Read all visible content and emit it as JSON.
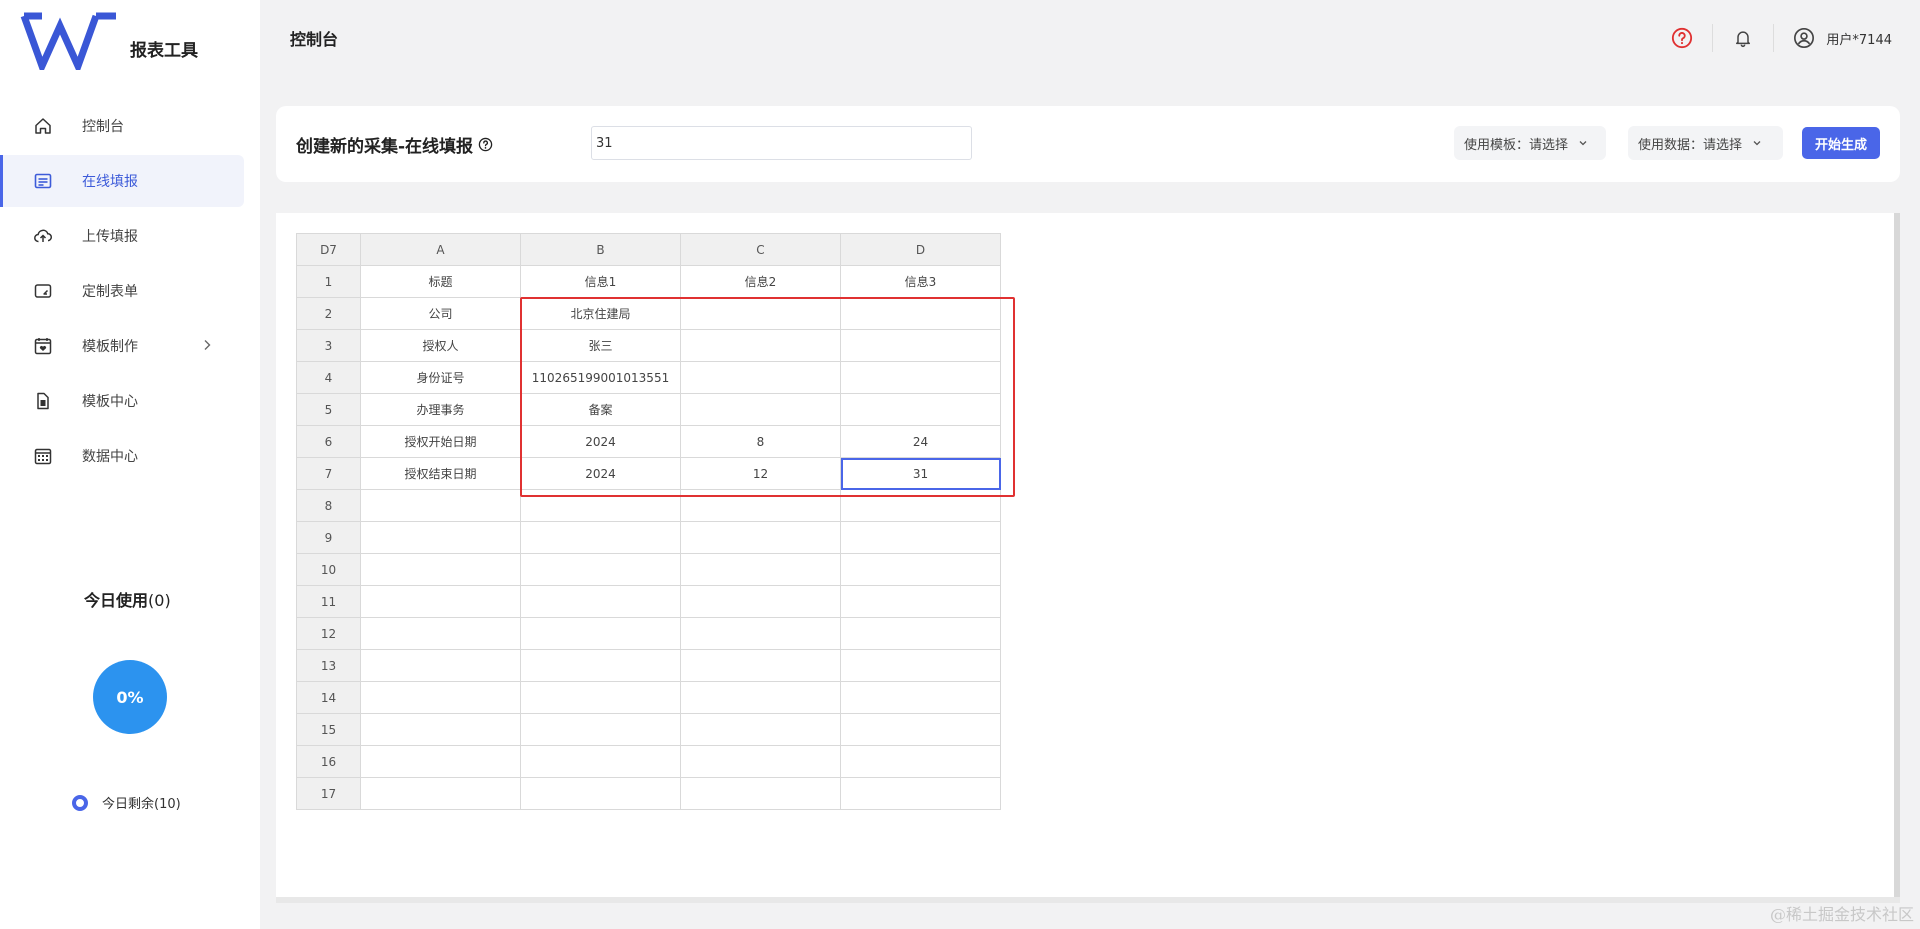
{
  "app": {
    "name": "报表工具"
  },
  "sidebar": {
    "items": [
      {
        "label": "控制台",
        "icon": "home-icon",
        "active": false
      },
      {
        "label": "在线填报",
        "icon": "form-icon",
        "active": true
      },
      {
        "label": "上传填报",
        "icon": "cloud-upload-icon",
        "active": false
      },
      {
        "label": "定制表单",
        "icon": "custom-form-icon",
        "active": false
      },
      {
        "label": "模板制作",
        "icon": "template-icon",
        "active": false,
        "has_submenu": true
      },
      {
        "label": "模板中心",
        "icon": "document-icon",
        "active": false
      },
      {
        "label": "数据中心",
        "icon": "calendar-grid-icon",
        "active": false
      }
    ],
    "usage": {
      "title": "今日使用",
      "count": "(0)",
      "percent": "0%",
      "remaining_label": "今日剩余(10)"
    }
  },
  "header": {
    "title": "控制台",
    "user": "用户*7144"
  },
  "top_card": {
    "title": "创建新的采集-在线填报",
    "name_value": "31",
    "template_select": "使用模板：请选择",
    "data_select": "使用数据：请选择",
    "generate_label": "开始生成"
  },
  "sheet": {
    "corner": "D7",
    "columns": [
      "A",
      "B",
      "C",
      "D"
    ],
    "rows": [
      {
        "n": "1",
        "cells": [
          "标题",
          "信息1",
          "信息2",
          "信息3"
        ]
      },
      {
        "n": "2",
        "cells": [
          "公司",
          "北京住建局",
          "",
          ""
        ]
      },
      {
        "n": "3",
        "cells": [
          "授权人",
          "张三",
          "",
          ""
        ]
      },
      {
        "n": "4",
        "cells": [
          "身份证号",
          "110265199001013551",
          "",
          ""
        ]
      },
      {
        "n": "5",
        "cells": [
          "办理事务",
          "备案",
          "",
          ""
        ]
      },
      {
        "n": "6",
        "cells": [
          "授权开始日期",
          "2024",
          "8",
          "24"
        ]
      },
      {
        "n": "7",
        "cells": [
          "授权结束日期",
          "2024",
          "12",
          "31"
        ]
      },
      {
        "n": "8",
        "cells": [
          "",
          "",
          "",
          ""
        ]
      },
      {
        "n": "9",
        "cells": [
          "",
          "",
          "",
          ""
        ]
      },
      {
        "n": "10",
        "cells": [
          "",
          "",
          "",
          ""
        ]
      },
      {
        "n": "11",
        "cells": [
          "",
          "",
          "",
          ""
        ]
      },
      {
        "n": "12",
        "cells": [
          "",
          "",
          "",
          ""
        ]
      },
      {
        "n": "13",
        "cells": [
          "",
          "",
          "",
          ""
        ]
      },
      {
        "n": "14",
        "cells": [
          "",
          "",
          "",
          ""
        ]
      },
      {
        "n": "15",
        "cells": [
          "",
          "",
          "",
          ""
        ]
      },
      {
        "n": "16",
        "cells": [
          "",
          "",
          "",
          ""
        ]
      },
      {
        "n": "17",
        "cells": [
          "",
          "",
          "",
          ""
        ]
      }
    ],
    "selected_cell": "D7"
  },
  "watermark": "@稀土掘金技术社区",
  "colors": {
    "accent": "#4a66e8",
    "highlight": "#e03131",
    "usage_circle": "#2c93ef",
    "help": "#e03131"
  }
}
